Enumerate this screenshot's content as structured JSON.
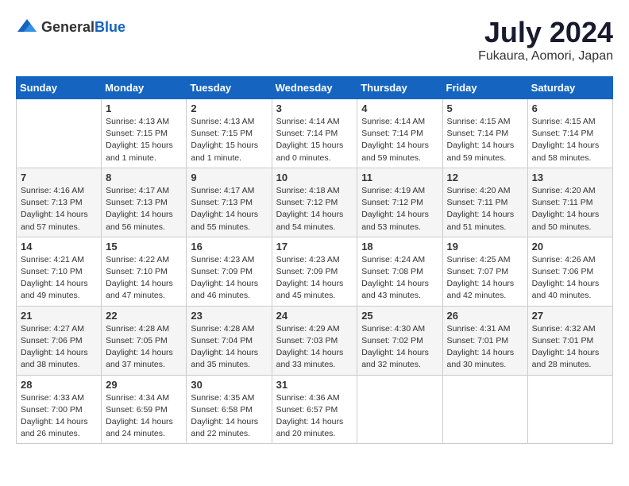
{
  "header": {
    "logo_general": "General",
    "logo_blue": "Blue",
    "title": "July 2024",
    "subtitle": "Fukaura, Aomori, Japan"
  },
  "calendar": {
    "days_of_week": [
      "Sunday",
      "Monday",
      "Tuesday",
      "Wednesday",
      "Thursday",
      "Friday",
      "Saturday"
    ],
    "weeks": [
      [
        {
          "day": "",
          "info": ""
        },
        {
          "day": "1",
          "info": "Sunrise: 4:13 AM\nSunset: 7:15 PM\nDaylight: 15 hours\nand 1 minute."
        },
        {
          "day": "2",
          "info": "Sunrise: 4:13 AM\nSunset: 7:15 PM\nDaylight: 15 hours\nand 1 minute."
        },
        {
          "day": "3",
          "info": "Sunrise: 4:14 AM\nSunset: 7:14 PM\nDaylight: 15 hours\nand 0 minutes."
        },
        {
          "day": "4",
          "info": "Sunrise: 4:14 AM\nSunset: 7:14 PM\nDaylight: 14 hours\nand 59 minutes."
        },
        {
          "day": "5",
          "info": "Sunrise: 4:15 AM\nSunset: 7:14 PM\nDaylight: 14 hours\nand 59 minutes."
        },
        {
          "day": "6",
          "info": "Sunrise: 4:15 AM\nSunset: 7:14 PM\nDaylight: 14 hours\nand 58 minutes."
        }
      ],
      [
        {
          "day": "7",
          "info": "Sunrise: 4:16 AM\nSunset: 7:13 PM\nDaylight: 14 hours\nand 57 minutes."
        },
        {
          "day": "8",
          "info": "Sunrise: 4:17 AM\nSunset: 7:13 PM\nDaylight: 14 hours\nand 56 minutes."
        },
        {
          "day": "9",
          "info": "Sunrise: 4:17 AM\nSunset: 7:13 PM\nDaylight: 14 hours\nand 55 minutes."
        },
        {
          "day": "10",
          "info": "Sunrise: 4:18 AM\nSunset: 7:12 PM\nDaylight: 14 hours\nand 54 minutes."
        },
        {
          "day": "11",
          "info": "Sunrise: 4:19 AM\nSunset: 7:12 PM\nDaylight: 14 hours\nand 53 minutes."
        },
        {
          "day": "12",
          "info": "Sunrise: 4:20 AM\nSunset: 7:11 PM\nDaylight: 14 hours\nand 51 minutes."
        },
        {
          "day": "13",
          "info": "Sunrise: 4:20 AM\nSunset: 7:11 PM\nDaylight: 14 hours\nand 50 minutes."
        }
      ],
      [
        {
          "day": "14",
          "info": "Sunrise: 4:21 AM\nSunset: 7:10 PM\nDaylight: 14 hours\nand 49 minutes."
        },
        {
          "day": "15",
          "info": "Sunrise: 4:22 AM\nSunset: 7:10 PM\nDaylight: 14 hours\nand 47 minutes."
        },
        {
          "day": "16",
          "info": "Sunrise: 4:23 AM\nSunset: 7:09 PM\nDaylight: 14 hours\nand 46 minutes."
        },
        {
          "day": "17",
          "info": "Sunrise: 4:23 AM\nSunset: 7:09 PM\nDaylight: 14 hours\nand 45 minutes."
        },
        {
          "day": "18",
          "info": "Sunrise: 4:24 AM\nSunset: 7:08 PM\nDaylight: 14 hours\nand 43 minutes."
        },
        {
          "day": "19",
          "info": "Sunrise: 4:25 AM\nSunset: 7:07 PM\nDaylight: 14 hours\nand 42 minutes."
        },
        {
          "day": "20",
          "info": "Sunrise: 4:26 AM\nSunset: 7:06 PM\nDaylight: 14 hours\nand 40 minutes."
        }
      ],
      [
        {
          "day": "21",
          "info": "Sunrise: 4:27 AM\nSunset: 7:06 PM\nDaylight: 14 hours\nand 38 minutes."
        },
        {
          "day": "22",
          "info": "Sunrise: 4:28 AM\nSunset: 7:05 PM\nDaylight: 14 hours\nand 37 minutes."
        },
        {
          "day": "23",
          "info": "Sunrise: 4:28 AM\nSunset: 7:04 PM\nDaylight: 14 hours\nand 35 minutes."
        },
        {
          "day": "24",
          "info": "Sunrise: 4:29 AM\nSunset: 7:03 PM\nDaylight: 14 hours\nand 33 minutes."
        },
        {
          "day": "25",
          "info": "Sunrise: 4:30 AM\nSunset: 7:02 PM\nDaylight: 14 hours\nand 32 minutes."
        },
        {
          "day": "26",
          "info": "Sunrise: 4:31 AM\nSunset: 7:01 PM\nDaylight: 14 hours\nand 30 minutes."
        },
        {
          "day": "27",
          "info": "Sunrise: 4:32 AM\nSunset: 7:01 PM\nDaylight: 14 hours\nand 28 minutes."
        }
      ],
      [
        {
          "day": "28",
          "info": "Sunrise: 4:33 AM\nSunset: 7:00 PM\nDaylight: 14 hours\nand 26 minutes."
        },
        {
          "day": "29",
          "info": "Sunrise: 4:34 AM\nSunset: 6:59 PM\nDaylight: 14 hours\nand 24 minutes."
        },
        {
          "day": "30",
          "info": "Sunrise: 4:35 AM\nSunset: 6:58 PM\nDaylight: 14 hours\nand 22 minutes."
        },
        {
          "day": "31",
          "info": "Sunrise: 4:36 AM\nSunset: 6:57 PM\nDaylight: 14 hours\nand 20 minutes."
        },
        {
          "day": "",
          "info": ""
        },
        {
          "day": "",
          "info": ""
        },
        {
          "day": "",
          "info": ""
        }
      ]
    ]
  }
}
